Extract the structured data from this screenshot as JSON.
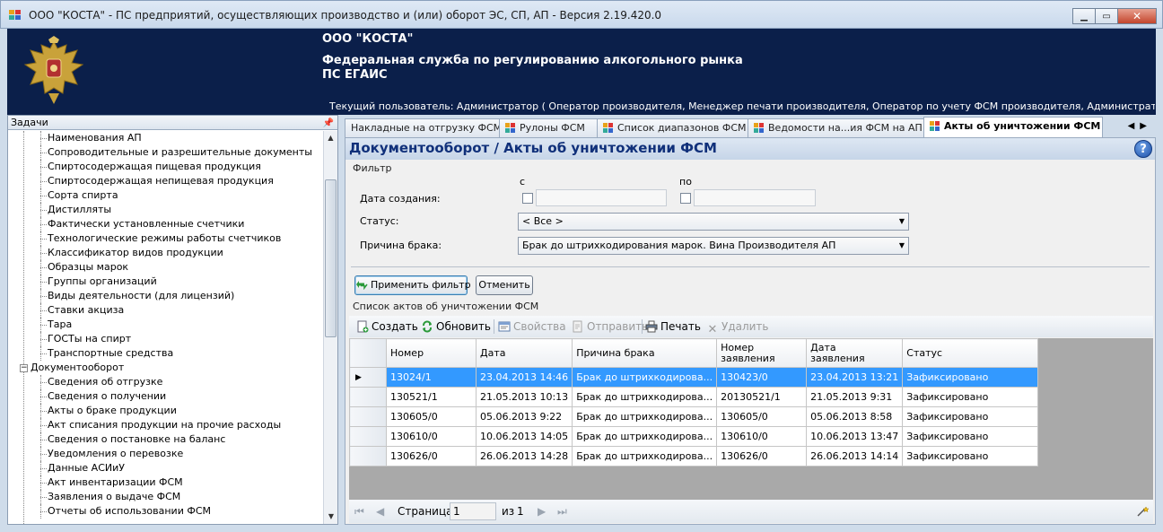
{
  "window": {
    "title": "ООО \"КОСТА\" - ПС предприятий, осуществляющих производство и (или) оборот ЭС, СП, АП - Версия 2.19.420.0",
    "controls": [
      "minimize-icon",
      "maximize-icon",
      "close-icon"
    ]
  },
  "banner": {
    "org": "ООО \"КОСТА\"",
    "federal_service": "Федеральная служба по регулированию алкогольного рынка",
    "system": "ПС ЕГАИС",
    "current_user": "Текущий пользователь: Администратор ( Оператор производителя, Менеджер печати производителя, Оператор по учету ФСМ производителя, Администратор производителя, О..."
  },
  "tasks_pane": {
    "title": "Задачи",
    "pin_icon": "pin-icon",
    "items": [
      {
        "label": "Наименования АП",
        "level": 2
      },
      {
        "label": "Сопроводительные и разрешительные документы",
        "level": 2
      },
      {
        "label": "Спиртосодержащая пищевая продукция",
        "level": 2
      },
      {
        "label": "Спиртосодержащая непищевая продукция",
        "level": 2
      },
      {
        "label": "Сорта спирта",
        "level": 2
      },
      {
        "label": "Дистилляты",
        "level": 2
      },
      {
        "label": "Фактически установленные счетчики",
        "level": 2
      },
      {
        "label": "Технологические режимы работы счетчиков",
        "level": 2
      },
      {
        "label": "Классификатор видов продукции",
        "level": 2
      },
      {
        "label": "Образцы марок",
        "level": 2
      },
      {
        "label": "Группы организаций",
        "level": 2
      },
      {
        "label": "Виды деятельности (для лицензий)",
        "level": 2
      },
      {
        "label": "Ставки акциза",
        "level": 2
      },
      {
        "label": "Тара",
        "level": 2
      },
      {
        "label": "ГОСТы на спирт",
        "level": 2
      },
      {
        "label": "Транспортные средства",
        "level": 2
      },
      {
        "label": "Документооборот",
        "level": 1,
        "expander": "−"
      },
      {
        "label": "Сведения об отгрузке",
        "level": 2
      },
      {
        "label": "Сведения о получении",
        "level": 2
      },
      {
        "label": "Акты о браке продукции",
        "level": 2
      },
      {
        "label": "Акт списания продукции на прочие расходы",
        "level": 2
      },
      {
        "label": "Сведения о постановке на баланс",
        "level": 2
      },
      {
        "label": "Уведомления о перевозке",
        "level": 2
      },
      {
        "label": "Данные АСИиУ",
        "level": 2
      },
      {
        "label": "Акт инвентаризации ФСМ",
        "level": 2
      },
      {
        "label": "Заявления о выдаче ФСМ",
        "level": 2
      },
      {
        "label": "Отчеты об использовании ФСМ",
        "level": 2
      }
    ]
  },
  "tabs": [
    {
      "label": "Накладные на отгрузку ФСМ",
      "active": false
    },
    {
      "label": "Рулоны ФСМ",
      "active": false
    },
    {
      "label": "Список диапазонов ФСМ",
      "active": false
    },
    {
      "label": "Ведомости на...ия ФСМ на АП",
      "active": false
    },
    {
      "label": "Акты об уничтожении ФСМ",
      "active": true,
      "close": "×"
    }
  ],
  "tab_nav": {
    "prev": "◀",
    "next": "▶"
  },
  "content": {
    "title": "Документооборот / Акты об уничтожении ФСМ",
    "help": "?",
    "filter": {
      "group_label": "Фильтр",
      "from_label": "с",
      "to_label": "по",
      "created_label": "Дата создания:",
      "status_label": "Статус:",
      "status_value": "< Все >",
      "reason_label": "Причина брака:",
      "reason_value": "Брак до штрихкодирования марок. Вина Производителя АП",
      "apply_button": "Применить фильтр",
      "cancel_button": "Отменить"
    },
    "list": {
      "group_label": "Список актов об уничтожении ФСМ",
      "toolbar": {
        "create": "Создать",
        "refresh": "Обновить",
        "properties": "Свойства",
        "send": "Отправить",
        "print": "Печать",
        "delete": "Удалить"
      },
      "columns": [
        "Номер",
        "Дата",
        "Причина брака",
        "Номер заявления",
        "Дата заявления",
        "Статус"
      ],
      "columns_split": [
        [
          "Номер"
        ],
        [
          "Дата"
        ],
        [
          "Причина брака"
        ],
        [
          "Номер",
          "заявления"
        ],
        [
          "Дата",
          "заявления"
        ],
        [
          "Статус"
        ]
      ],
      "rows": [
        {
          "number": "13024/1",
          "date": "23.04.2013 14:46",
          "reason": "Брак до штрихкодирова...",
          "app_number": "130423/0",
          "app_date": "23.04.2013 13:21",
          "status": "Зафиксировано",
          "selected": true
        },
        {
          "number": "130521/1",
          "date": "21.05.2013 10:13",
          "reason": "Брак до штрихкодирова...",
          "app_number": "20130521/1",
          "app_date": "21.05.2013 9:31",
          "status": "Зафиксировано",
          "selected": false
        },
        {
          "number": "130605/0",
          "date": "05.06.2013 9:22",
          "reason": "Брак до штрихкодирова...",
          "app_number": "130605/0",
          "app_date": "05.06.2013 8:58",
          "status": "Зафиксировано",
          "selected": false
        },
        {
          "number": "130610/0",
          "date": "10.06.2013 14:05",
          "reason": "Брак до штрихкодирова...",
          "app_number": "130610/0",
          "app_date": "10.06.2013 13:47",
          "status": "Зафиксировано",
          "selected": false
        },
        {
          "number": "130626/0",
          "date": "26.06.2013 14:28",
          "reason": "Брак до штрихкодирова...",
          "app_number": "130626/0",
          "app_date": "26.06.2013 14:14",
          "status": "Зафиксировано",
          "selected": false
        }
      ],
      "row_indicator": "▶"
    },
    "pager": {
      "first": "⏮",
      "prev": "◀",
      "page_label": "Страница",
      "page_value": "1",
      "of_label": "из",
      "total": "1",
      "next": "▶",
      "last": "⏭"
    }
  },
  "colors": {
    "banner_bg": "#0b1f4a",
    "title_blue": "#10307a",
    "selection": "#3399ff"
  }
}
